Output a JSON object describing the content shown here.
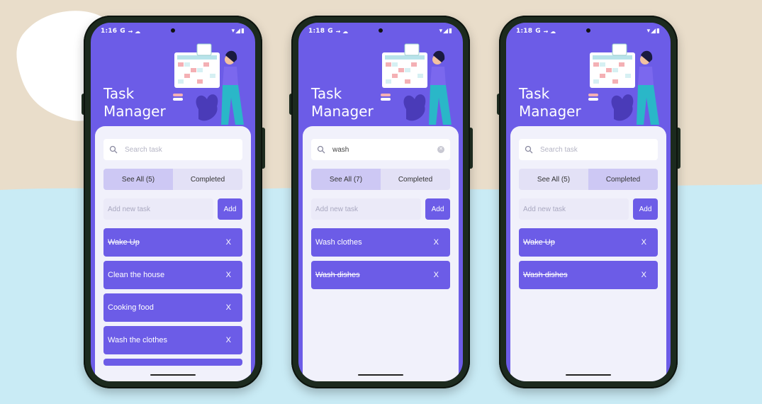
{
  "brand": {
    "primary": "#6c5ce7",
    "panel": "#f1f1fb",
    "tab_active": "#cdc8f4"
  },
  "phones": [
    {
      "status": {
        "time": "1:16",
        "g": "G",
        "extra": "⇝ ☁",
        "right": "▾◢▮"
      },
      "title_line1": "Task",
      "title_line2": "Manager",
      "search": {
        "value": "",
        "placeholder": "Search task"
      },
      "tabs": [
        {
          "label": "See All (5)",
          "active": true
        },
        {
          "label": "Completed",
          "active": false
        }
      ],
      "add": {
        "placeholder": "Add new task",
        "button": "Add"
      },
      "tasks": [
        {
          "text": "Wake Up",
          "done": true,
          "remove": "X"
        },
        {
          "text": "Clean the house",
          "done": false,
          "remove": "X"
        },
        {
          "text": "Cooking food",
          "done": false,
          "remove": "X"
        },
        {
          "text": "Wash the clothes",
          "done": false,
          "remove": "X"
        }
      ]
    },
    {
      "status": {
        "time": "1:18",
        "g": "G",
        "extra": "⇝ ☁",
        "right": "▾◢▮"
      },
      "title_line1": "Task",
      "title_line2": "Manager",
      "search": {
        "value": "wash",
        "placeholder": "Search task"
      },
      "tabs": [
        {
          "label": "See All (7)",
          "active": true
        },
        {
          "label": "Completed",
          "active": false
        }
      ],
      "add": {
        "placeholder": "Add new task",
        "button": "Add"
      },
      "tasks": [
        {
          "text": "Wash clothes",
          "done": false,
          "remove": "X"
        },
        {
          "text": "Wash dishes",
          "done": true,
          "remove": "X"
        }
      ]
    },
    {
      "status": {
        "time": "1:18",
        "g": "G",
        "extra": "⇝ ☁",
        "right": "▾◢▮"
      },
      "title_line1": "Task",
      "title_line2": "Manager",
      "search": {
        "value": "",
        "placeholder": "Search task"
      },
      "tabs": [
        {
          "label": "See All (5)",
          "active": false
        },
        {
          "label": "Completed",
          "active": true
        }
      ],
      "add": {
        "placeholder": "Add new task",
        "button": "Add"
      },
      "tasks": [
        {
          "text": "Wake Up",
          "done": true,
          "remove": "X"
        },
        {
          "text": "Wash dishes",
          "done": true,
          "remove": "X"
        }
      ]
    }
  ]
}
